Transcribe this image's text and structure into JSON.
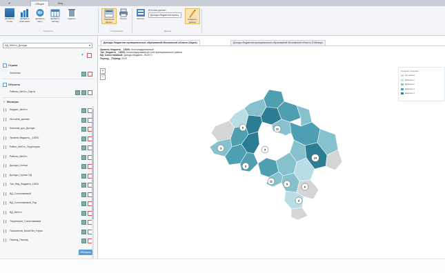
{
  "app": {
    "tabs": [
      "Ф",
      "Общее",
      "Вид"
    ],
    "active_tab": 1
  },
  "ribbon": {
    "buttons": [
      {
        "label": "Добавить строку",
        "icon": "add-row-icon",
        "color": "#3b82c4"
      },
      {
        "label": "Добавить диаграмму",
        "icon": "chart-icon",
        "color": "#2f6fb0"
      },
      {
        "label": "Добавить карту",
        "icon": "map-icon",
        "color": "#3a8fc8"
      },
      {
        "label": "Добавить таблицу",
        "icon": "table-icon",
        "color": "#4a7fb5"
      },
      {
        "label": "Удалить",
        "icon": "delete-icon",
        "color": "#8aa0b8"
      },
      {
        "label": "Подсветка данных",
        "icon": "highlight-icon",
        "color": "#5d7fb1"
      },
      {
        "label": "Печать",
        "icon": "print-icon",
        "color": "#6b7f95"
      },
      {
        "label": "Экспорт",
        "icon": "export-icon",
        "color": "#4a86c8"
      },
      {
        "label": "Изменить данные",
        "icon": "edit-data-icon",
        "color": "#d4a030"
      }
    ],
    "combo_caption": "Источник данных",
    "combo_value": "Доходы бюджетов муниц.",
    "groups": [
      "Элементы",
      "Отображение",
      "Данные"
    ]
  },
  "left_panel": {
    "dropdown_value": "ИД_МнОтч_Доходы",
    "rows_title": "Строки",
    "rows": [
      "Значения"
    ],
    "columns_title": "Объекты",
    "columns": [
      "Районы_МнОтч_Карта"
    ],
    "filters_title": "Фильтры",
    "filters": [
      "Бюджет_МнОтч",
      "Источник_данных",
      "Классиф_дох_Доходы",
      "Уровень бюджета__13000",
      "Район_МнОтч_Территория",
      "Районы_МнОтч",
      "Доходы_Статьи",
      "Доходы_Группы ОД",
      "Тип_Фед_бюджета_13000",
      "ВД_Сопоставимый",
      "ВД_Сопоставимый_Ред",
      "ВД_МнОтч",
      "Территории_Сопоставимые",
      "Показатели_МоскОбл_Учреж",
      "Период_Период"
    ],
    "apply_label": "Обновить"
  },
  "doc_tabs": [
    "Доходы бюджетов муниципальных образований Московской области (Карта)",
    "Доходы бюджетов муниципальных образований Московской области (Таблица)"
  ],
  "info_lines": [
    {
      "key": "Уровень бюджета__13000:",
      "value": "Консолидированный"
    },
    {
      "key": "Тип_бюджета__13000:",
      "value": "Консолидированный отчет муниципального района"
    },
    {
      "key": "ВД_Сопоставимый:",
      "value": "Доходы бюджета - ВСЕГО"
    },
    {
      "key": "Период__Период:",
      "value": "2019"
    }
  ],
  "zoom": {
    "in": "+",
    "out": "−"
  },
  "legend": {
    "title": "Средние значения",
    "items": [
      {
        "label": "Нет данных",
        "color": "#d4d5d7"
      },
      {
        "label": "Диапазон 1",
        "color": "#b9dde4"
      },
      {
        "label": "Диапазон 2",
        "color": "#86c1cd"
      },
      {
        "label": "Диапазон 3",
        "color": "#4d9fb1"
      },
      {
        "label": "Диапазон 4",
        "color": "#2c7d93"
      }
    ]
  },
  "map": {
    "markers": [
      "6",
      "11",
      "3",
      "4",
      "3",
      "24",
      "5",
      "11",
      "6",
      "3"
    ]
  }
}
